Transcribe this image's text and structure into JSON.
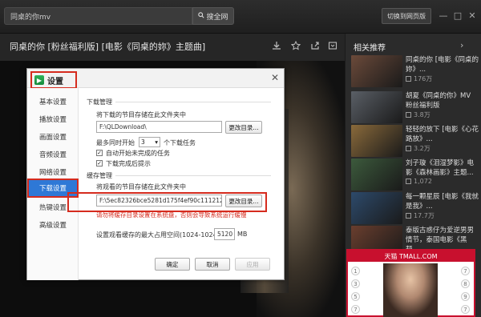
{
  "topbar": {
    "search_value": "同桌的你mv",
    "search_button": "搜全网",
    "web_button": "切换到网页版",
    "min_icon": "—",
    "max_icon": "□",
    "close_icon": "✕"
  },
  "video": {
    "title": "同桌的你 [粉丝福利版] [电影《同桌的妳》主题曲]"
  },
  "sidebar": {
    "title": "相关推荐",
    "arrow": "›",
    "items": [
      {
        "title": "同桌的你 [电影《同桌的妳》...",
        "views": "176万",
        "color": "#6b4a3a"
      },
      {
        "title": "胡夏《同桌的你》MV 粉丝福利版",
        "views": "3.8万",
        "color": "#5a5f66"
      },
      {
        "title": "轻轻的放下 [电影《心花路放》...",
        "views": "3.2万",
        "color": "#8a6a3b"
      },
      {
        "title": "刘子璇《泪湿梦影》电影《森林画影》主题...",
        "views": "1,072",
        "color": "#3c5a3c"
      },
      {
        "title": "每一颗星辰 [电影《我就是我》...",
        "views": "17.7万",
        "color": "#2d4a6b"
      },
      {
        "title": "泰版古惑仔为爱逆男男情节，泰国电影《黑帮...",
        "views": "",
        "color": "#6a3e2e"
      }
    ]
  },
  "ad": {
    "header": "天猫 TMALL.COM",
    "nums_left": [
      "1",
      "3",
      "5",
      "7"
    ],
    "nums_right": [
      "7",
      "8",
      "9",
      "7"
    ]
  },
  "dialog": {
    "title": "设置",
    "close": "✕",
    "menu": [
      "基本设置",
      "播放设置",
      "画面设置",
      "音频设置",
      "网络设置",
      "下载设置",
      "热键设置",
      "高级设置"
    ],
    "download_section": "下载管理",
    "download_label": "将下载的节目存储在此文件夹中",
    "download_path": "F:\\QLDownload\\",
    "change_dir": "更改目录...",
    "max_start_label": "最多同时开始",
    "max_start_value": "3",
    "max_start_suffix": "个下载任务",
    "auto_start": "自动开始未完成的任务",
    "done_prompt": "下载完成后提示",
    "cache_section": "缓存管理",
    "cache_label": "将观看的节目存储在此文件夹中",
    "cache_path": "F:\\5ec82326bce5281d175f4ef90c111212\\",
    "warning": "请勿将缓存目录设置在系统盘，否则会导致系统运行缓慢",
    "max_cache_label": "设置观看缓存的最大占用空间(1024-10240)",
    "max_cache_value": "5120",
    "max_cache_unit": "MB",
    "ok": "确定",
    "cancel": "取消",
    "apply": "应用"
  }
}
